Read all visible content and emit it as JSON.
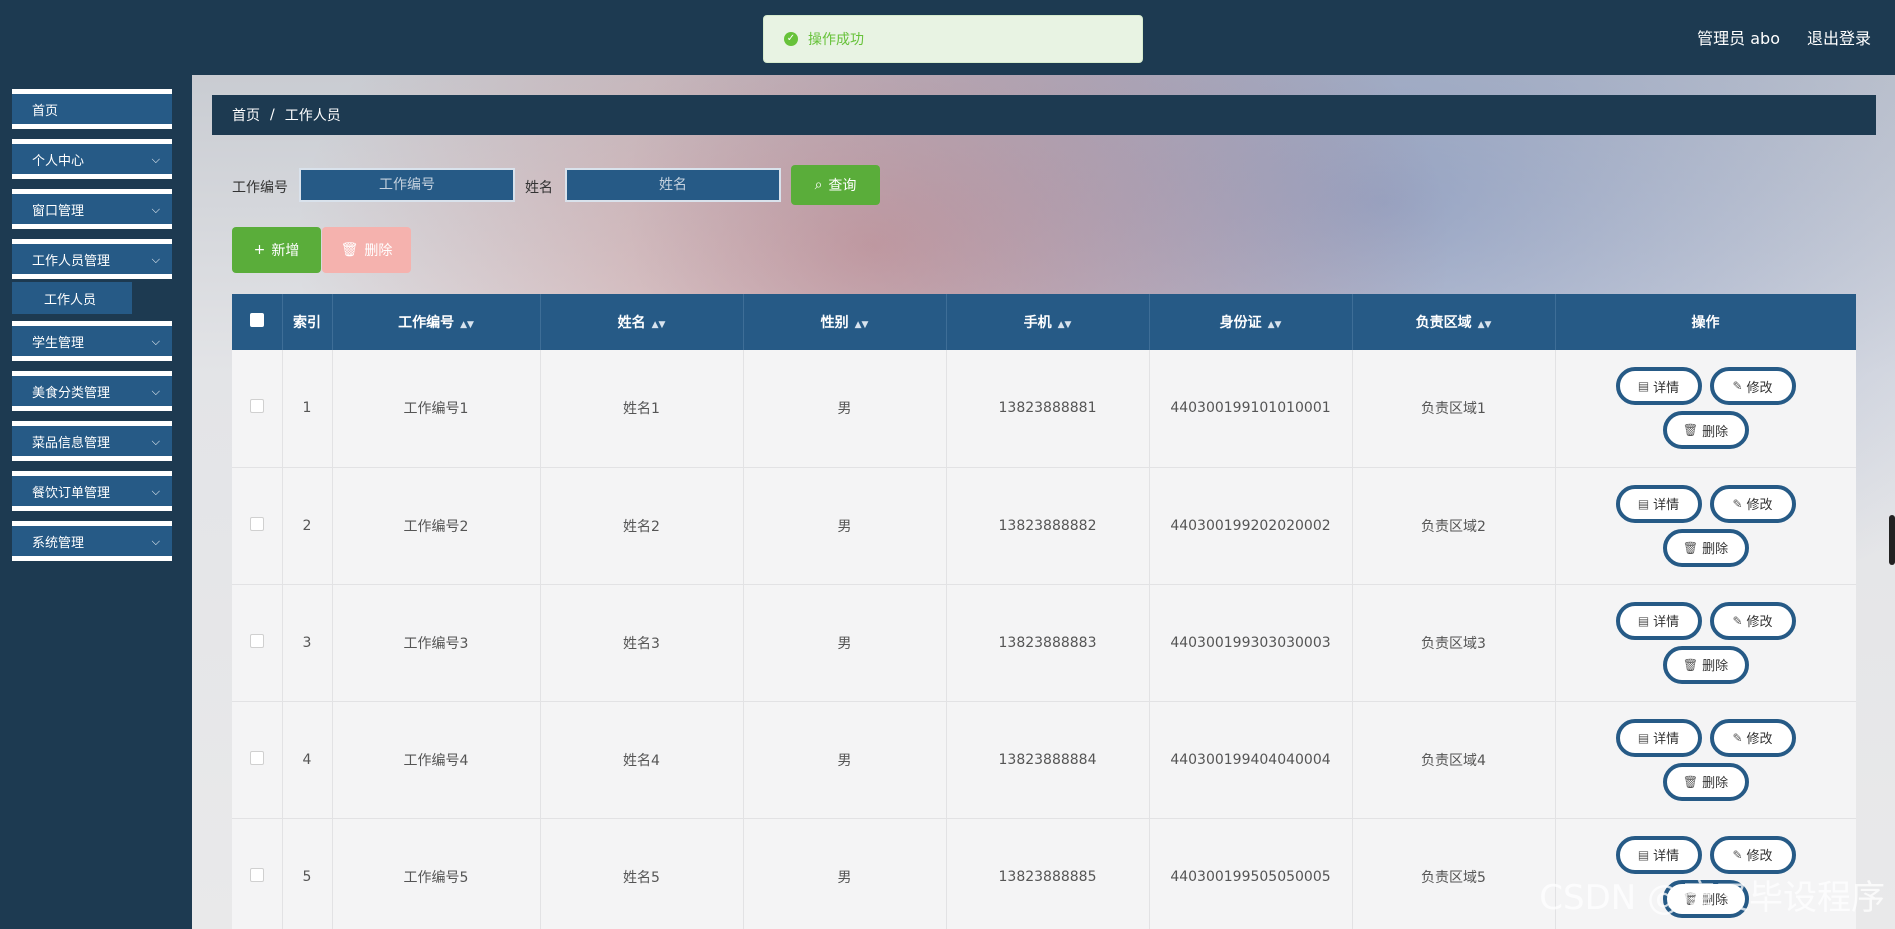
{
  "header": {
    "user": "管理员 abo",
    "logout": "退出登录"
  },
  "toast": {
    "message": "操作成功"
  },
  "sidebar": {
    "items": [
      {
        "label": "首页",
        "has_children": false
      },
      {
        "label": "个人中心",
        "has_children": true
      },
      {
        "label": "窗口管理",
        "has_children": true
      },
      {
        "label": "工作人员管理",
        "has_children": true
      },
      {
        "label": "学生管理",
        "has_children": true
      },
      {
        "label": "美食分类管理",
        "has_children": true
      },
      {
        "label": "菜品信息管理",
        "has_children": true
      },
      {
        "label": "餐饮订单管理",
        "has_children": true
      },
      {
        "label": "系统管理",
        "has_children": true
      }
    ],
    "sub_item": "工作人员"
  },
  "breadcrumb": {
    "home": "首页",
    "sep": "/",
    "current": "工作人员"
  },
  "search": {
    "code_label": "工作编号",
    "code_placeholder": "工作编号",
    "name_label": "姓名",
    "name_placeholder": "姓名",
    "query_label": "查询"
  },
  "actions": {
    "add_label": "新增",
    "delete_label": "删除"
  },
  "table": {
    "columns": [
      "索引",
      "工作编号",
      "姓名",
      "性别",
      "手机",
      "身份证",
      "负责区域",
      "操作"
    ],
    "rows": [
      {
        "index": "1",
        "code": "工作编号1",
        "name": "姓名1",
        "gender": "男",
        "phone": "13823888881",
        "id_card": "440300199101010001",
        "area": "负责区域1"
      },
      {
        "index": "2",
        "code": "工作编号2",
        "name": "姓名2",
        "gender": "男",
        "phone": "13823888882",
        "id_card": "440300199202020002",
        "area": "负责区域2"
      },
      {
        "index": "3",
        "code": "工作编号3",
        "name": "姓名3",
        "gender": "男",
        "phone": "13823888883",
        "id_card": "440300199303030003",
        "area": "负责区域3"
      },
      {
        "index": "4",
        "code": "工作编号4",
        "name": "姓名4",
        "gender": "男",
        "phone": "13823888884",
        "id_card": "440300199404040004",
        "area": "负责区域4"
      },
      {
        "index": "5",
        "code": "工作编号5",
        "name": "姓名5",
        "gender": "男",
        "phone": "13823888885",
        "id_card": "440300199505050005",
        "area": "负责区域5"
      }
    ],
    "op_labels": {
      "detail": "详情",
      "edit": "修改",
      "delete": "删除"
    }
  },
  "watermark": "CSDN @唐叉毕设程序",
  "colors": {
    "nav": "#1d3a51",
    "accent": "#265a86",
    "success": "#5aad3a",
    "danger_light": "#f5b2ae"
  }
}
